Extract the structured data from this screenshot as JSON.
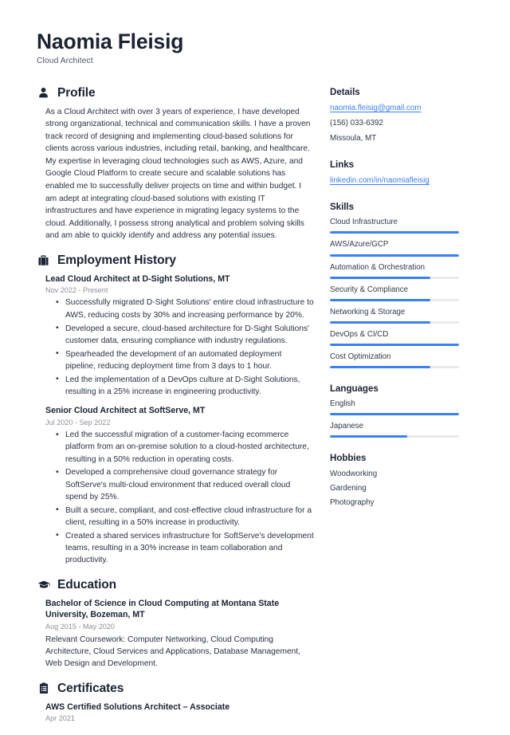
{
  "header": {
    "name": "Naomia Fleisig",
    "job_title": "Cloud Architect"
  },
  "accent_color": "#3b7ff5",
  "sections": {
    "profile": {
      "title": "Profile",
      "icon": "person-icon",
      "text": "As a Cloud Architect with over 3 years of experience, I have developed strong organizational, technical and communication skills. I have a proven track record of designing and implementing cloud-based solutions for clients across various industries, including retail, banking, and healthcare. My expertise in leveraging cloud technologies such as AWS, Azure, and Google Cloud Platform to create secure and scalable solutions has enabled me to successfully deliver projects on time and within budget. I am adept at integrating cloud-based solutions with existing IT infrastructures and have experience in migrating legacy systems to the cloud. Additionally, I possess strong analytical and problem solving skills and am able to quickly identify and address any potential issues."
    },
    "employment": {
      "title": "Employment History",
      "icon": "briefcase-icon",
      "entries": [
        {
          "title": "Lead Cloud Architect at D-Sight Solutions, MT",
          "date": "Nov 2022 - Present",
          "bullets": [
            "Successfully migrated D-Sight Solutions' entire cloud infrastructure to AWS, reducing costs by 30% and increasing performance by 20%.",
            "Developed a secure, cloud-based architecture for D-Sight Solutions' customer data, ensuring compliance with industry regulations.",
            "Spearheaded the development of an automated deployment pipeline, reducing deployment time from 3 days to 1 hour.",
            "Led the implementation of a DevOps culture at D-Sight Solutions, resulting in a 25% increase in engineering productivity."
          ]
        },
        {
          "title": "Senior Cloud Architect at SoftServe, MT",
          "date": "Jul 2020 - Sep 2022",
          "bullets": [
            "Led the successful migration of a customer-facing ecommerce platform from an on-premise solution to a cloud-hosted architecture, resulting in a 50% reduction in operating costs.",
            "Developed a comprehensive cloud governance strategy for SoftServe's multi-cloud environment that reduced overall cloud spend by 25%.",
            "Built a secure, compliant, and cost-effective cloud infrastructure for a client, resulting in a 50% increase in productivity.",
            "Created a shared services infrastructure for SoftServe's development teams, resulting in a 30% increase in team collaboration and productivity."
          ]
        }
      ]
    },
    "education": {
      "title": "Education",
      "icon": "graduation-cap-icon",
      "entries": [
        {
          "title": "Bachelor of Science in Cloud Computing at Montana State University, Bozeman, MT",
          "date": "Aug 2015 - May 2020",
          "description": "Relevant Coursework: Computer Networking, Cloud Computing Architecture, Cloud Services and Applications, Database Management, Web Design and Development."
        }
      ]
    },
    "certificates": {
      "title": "Certificates",
      "icon": "clipboard-icon",
      "entries": [
        {
          "title": "AWS Certified Solutions Architect – Associate",
          "date": "Apr 2021"
        }
      ]
    }
  },
  "sidebar": {
    "details": {
      "title": "Details",
      "email": "naomia.fleisig@gmail.com",
      "phone": "(156) 033-6392",
      "location": "Missoula, MT"
    },
    "links": {
      "title": "Links",
      "items": [
        {
          "label": "linkedin.com/in/naomiafleisig"
        }
      ]
    },
    "skills": {
      "title": "Skills",
      "items": [
        {
          "label": "Cloud Infrastructure",
          "level": 100
        },
        {
          "label": "AWS/Azure/GCP",
          "level": 100
        },
        {
          "label": "Automation & Orchestration",
          "level": 78
        },
        {
          "label": "Security & Compliance",
          "level": 78
        },
        {
          "label": "Networking & Storage",
          "level": 78
        },
        {
          "label": "DevOps & CI/CD",
          "level": 100
        },
        {
          "label": "Cost Optimization",
          "level": 78
        }
      ]
    },
    "languages": {
      "title": "Languages",
      "items": [
        {
          "label": "English",
          "level": 100
        },
        {
          "label": "Japanese",
          "level": 60
        }
      ]
    },
    "hobbies": {
      "title": "Hobbies",
      "items": [
        {
          "label": "Woodworking"
        },
        {
          "label": "Gardening"
        },
        {
          "label": "Photography"
        }
      ]
    }
  }
}
